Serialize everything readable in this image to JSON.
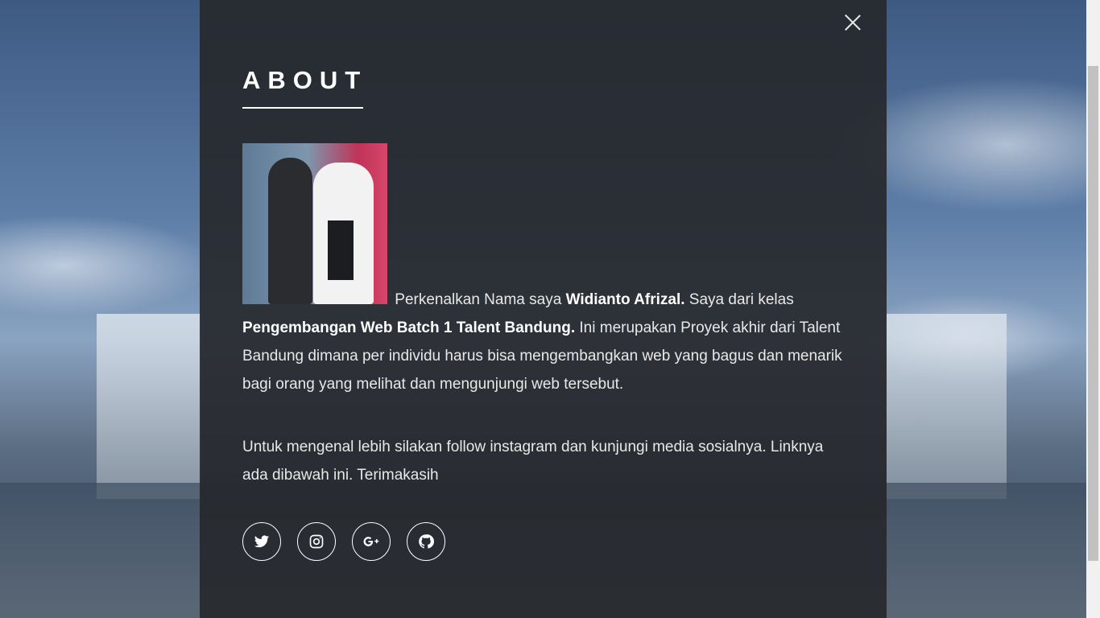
{
  "about": {
    "title": "ABOUT",
    "para1": {
      "intro": " Perkenalkan Nama saya ",
      "name": "Widianto Afrizal.",
      "mid": " Saya dari kelas ",
      "class_name": "Pengembangan Web Batch 1 Talent Bandung.",
      "rest": " Ini merupakan Proyek akhir dari Talent Bandung dimana per individu harus bisa mengembangkan web yang bagus dan menarik bagi orang yang melihat dan mengunjungi web tersebut."
    },
    "para2": "Untuk mengenal lebih silakan follow instagram dan kunjungi media sosialnya. Linknya ada dibawah ini. Terimakasih"
  },
  "social": [
    {
      "icon": "twitter-icon"
    },
    {
      "icon": "instagram-icon"
    },
    {
      "icon": "google-plus-icon"
    },
    {
      "icon": "github-icon"
    }
  ],
  "close_icon": "close-icon",
  "colors": {
    "panel": "#26282c",
    "text": "#e8e8e8"
  }
}
